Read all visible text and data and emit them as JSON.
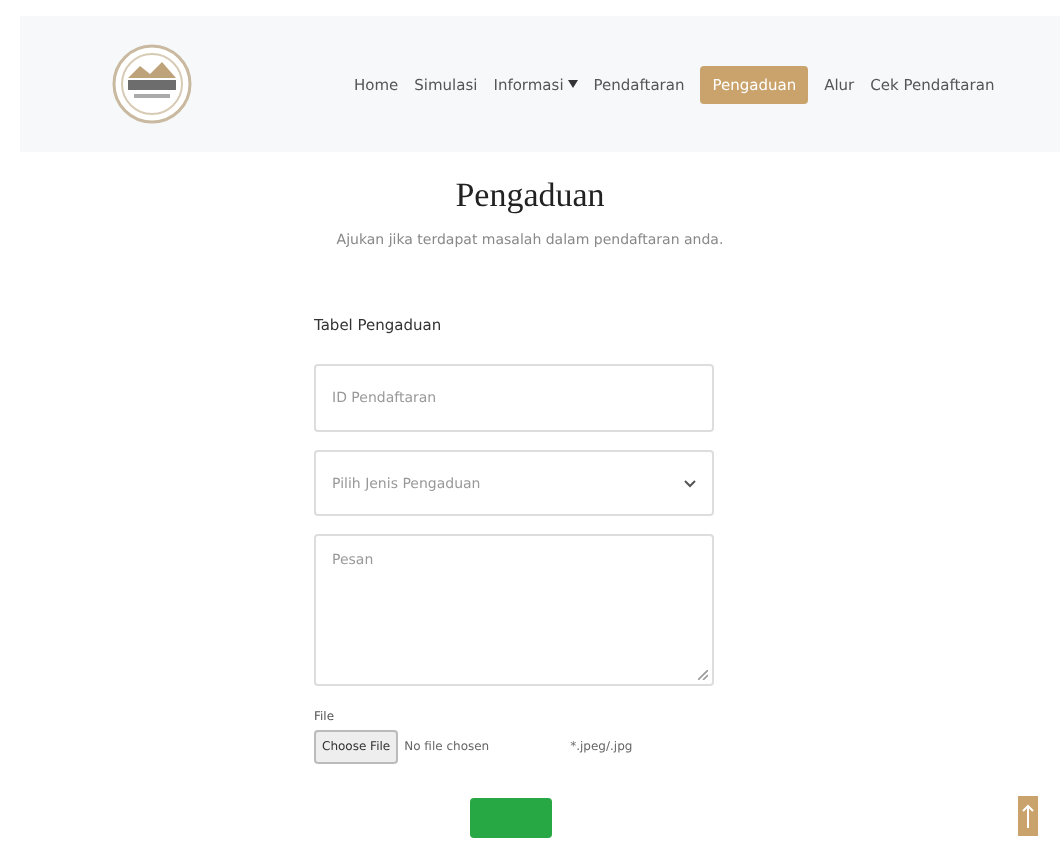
{
  "nav": {
    "items": [
      {
        "label": "Home",
        "selected": false,
        "dropdown": false
      },
      {
        "label": "Simulasi",
        "selected": false,
        "dropdown": false
      },
      {
        "label": "Informasi",
        "selected": false,
        "dropdown": true
      },
      {
        "label": "Pendaftaran",
        "selected": false,
        "dropdown": false
      },
      {
        "label": "Pengaduan",
        "selected": true,
        "dropdown": false
      },
      {
        "label": "Alur",
        "selected": false,
        "dropdown": false
      },
      {
        "label": "Cek Pendaftaran",
        "selected": false,
        "dropdown": false
      }
    ]
  },
  "heading": "Pengaduan",
  "subtitle": "Ajukan jika terdapat masalah dalam pendaftaran anda.",
  "form": {
    "title": "Tabel Pengaduan",
    "fields": [
      {
        "kind": "input",
        "placeholder": "ID Pendaftaran"
      },
      {
        "kind": "select",
        "placeholder": "Pilih Jenis Pengaduan"
      },
      {
        "kind": "textarea",
        "placeholder": "Pesan"
      }
    ],
    "file": {
      "label": "File",
      "button": "Choose File",
      "status": "No file chosen",
      "hint": "*.jpeg/.jpg"
    }
  }
}
